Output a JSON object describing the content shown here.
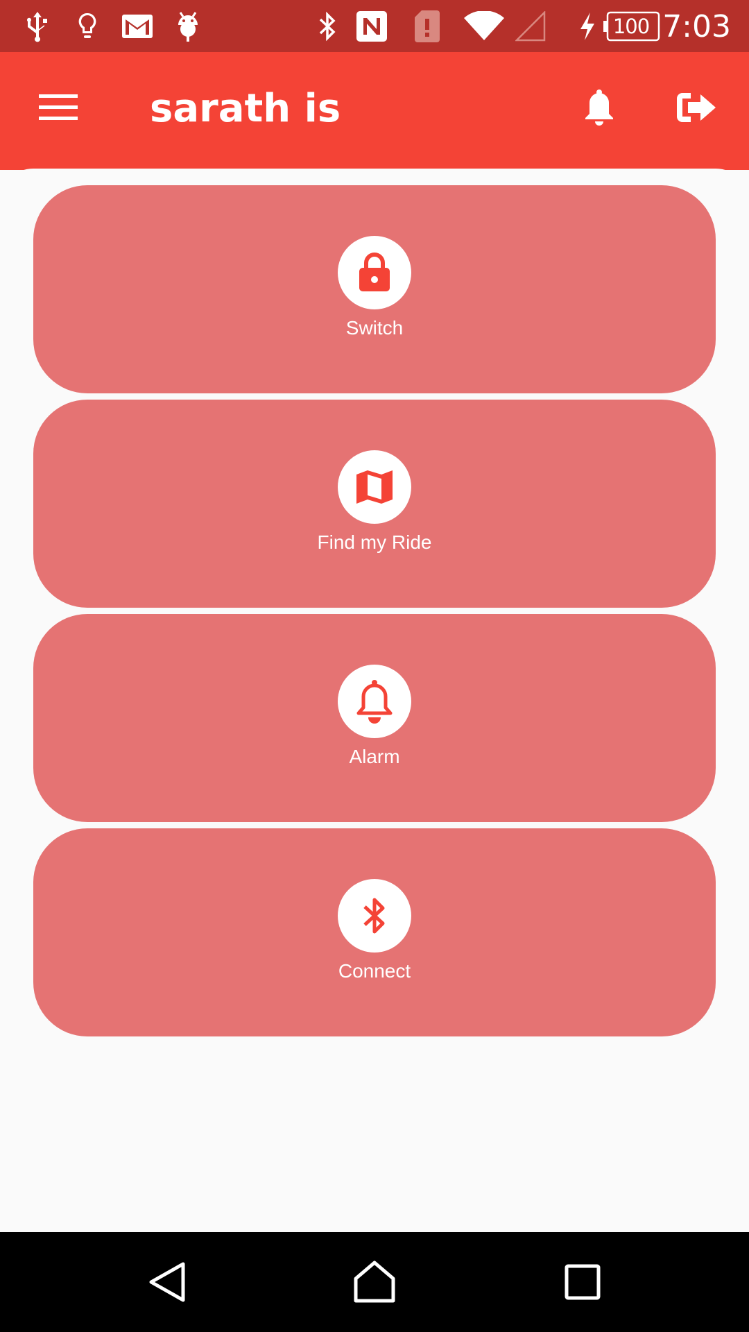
{
  "status_bar": {
    "icons": [
      "usb-icon",
      "lightbulb-icon",
      "gmail-icon",
      "android-icon",
      "bluetooth-icon",
      "nfc-icon",
      "sim-alert-icon",
      "wifi-icon",
      "cell-signal-icon",
      "charging-icon"
    ],
    "battery_level": "100",
    "time": "7:03"
  },
  "app_bar": {
    "title": "sarath is",
    "menu_icon": "menu-icon",
    "notification_icon": "bell-icon",
    "logout_icon": "logout-icon",
    "color": "#f44336"
  },
  "cards": [
    {
      "label": "Switch",
      "icon": "lock-icon"
    },
    {
      "label": "Find my Ride",
      "icon": "map-icon"
    },
    {
      "label": "Alarm",
      "icon": "bell-icon"
    },
    {
      "label": "Connect",
      "icon": "bluetooth-icon"
    }
  ],
  "colors": {
    "status_bar": "#b5302a",
    "app_bar": "#f44336",
    "card": "#e57373",
    "icon_accent": "#f44336"
  },
  "nav_bar": {
    "buttons": [
      "back-icon",
      "home-icon",
      "recents-icon"
    ]
  }
}
